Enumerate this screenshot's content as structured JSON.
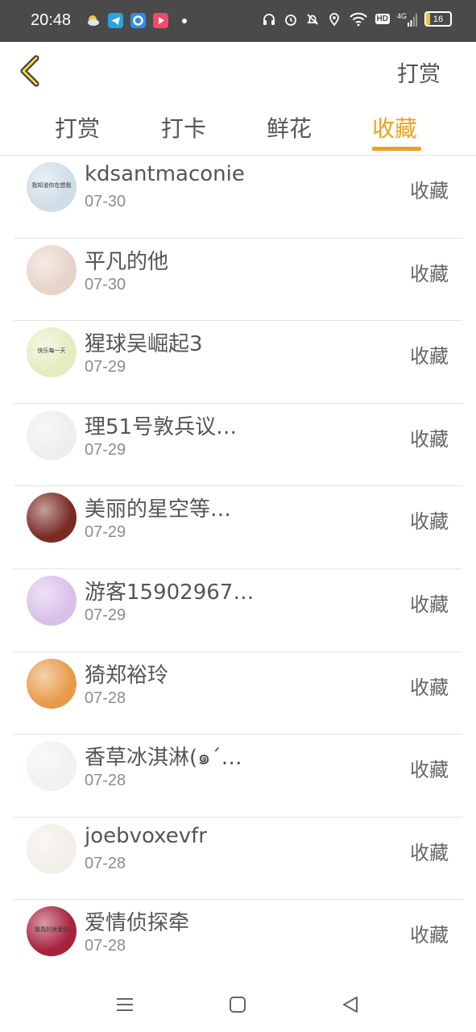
{
  "status_bar": {
    "time": "20:48",
    "network": "4G",
    "hd": "HD",
    "battery_percent": "16",
    "battery_level": 0.16,
    "left_icons": [
      "weather-icon",
      "telegram-icon",
      "browser-icon",
      "video-app-icon"
    ],
    "right_icons": [
      "headphones-icon",
      "alarm-icon",
      "bell-muted-icon",
      "location-icon",
      "wifi-icon"
    ]
  },
  "header": {
    "back_icon": "chevron-left-icon",
    "action_label": "打赏"
  },
  "tabs": [
    {
      "label": "打赏",
      "active": false
    },
    {
      "label": "打卡",
      "active": false
    },
    {
      "label": "鲜花",
      "active": false
    },
    {
      "label": "收藏",
      "active": true
    }
  ],
  "accent_color": "#f0a020",
  "list": [
    {
      "name": "kdsantmaconie",
      "date": "07-30",
      "action": "收藏",
      "avatar_color": "#cfdde6",
      "avatar_text": "我知道你在想我"
    },
    {
      "name": "平凡的他",
      "date": "07-30",
      "action": "收藏",
      "avatar_color": "#e7d3c7"
    },
    {
      "name": "猩球吴崛起3",
      "date": "07-29",
      "action": "收藏",
      "avatar_color": "#e5ecc0",
      "avatar_text": "快乐每一天"
    },
    {
      "name": "理51号敦兵议…",
      "date": "07-29",
      "action": "收藏",
      "avatar_color": "#eeeeee"
    },
    {
      "name": "美丽的星空等…",
      "date": "07-29",
      "action": "收藏",
      "avatar_color": "#7a2a24"
    },
    {
      "name": "游客15902967…",
      "date": "07-29",
      "action": "收藏",
      "avatar_color": "#d9c0ea"
    },
    {
      "name": "猗郑裕玲",
      "date": "07-28",
      "action": "收藏",
      "avatar_color": "#e89a4a"
    },
    {
      "name": "香草冰淇淋(๑´…",
      "date": "07-28",
      "action": "收藏",
      "avatar_color": "#f3f0f3"
    },
    {
      "name": "joebvoxevfr",
      "date": "07-28",
      "action": "收藏",
      "avatar_color": "#f2eee8"
    },
    {
      "name": "爱情侦探牵",
      "date": "07-28",
      "action": "收藏",
      "avatar_color": "#a8213d",
      "avatar_text": "我真的很爱你"
    }
  ],
  "nav_bar": {
    "buttons": [
      "menu-icon",
      "home-icon",
      "back-triangle-icon"
    ]
  }
}
